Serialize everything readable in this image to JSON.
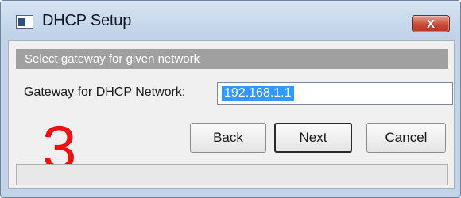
{
  "window": {
    "title": "DHCP Setup",
    "close_symbol": "X"
  },
  "banner": {
    "text": "Select gateway for given network"
  },
  "form": {
    "gateway_label": "Gateway for DHCP Network:",
    "gateway_value": "192.168.1.1"
  },
  "annotation": {
    "step_number": "3",
    "color": "#ee1111"
  },
  "buttons": {
    "back": "Back",
    "next": "Next",
    "cancel": "Cancel"
  },
  "colors": {
    "banner_bg": "#a0a0a0",
    "selection": "#3399ff",
    "close_button": "#c64a34"
  },
  "icons": {
    "app": "window-app-icon",
    "close": "close-icon"
  }
}
